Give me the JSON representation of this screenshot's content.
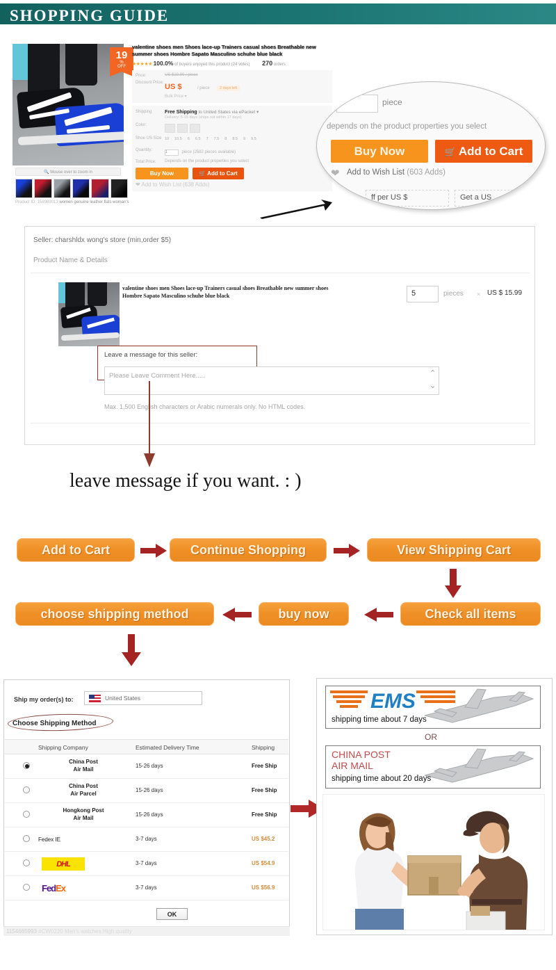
{
  "banner": {
    "title": "SHOPPING GUIDE",
    "color": "#1c7573"
  },
  "product_page": {
    "discount_badge": {
      "value": "19",
      "unit": "%",
      "label": "OFF"
    },
    "title": "valentine shoes men Shoes lace-up Trainers casual shoes Breathable new summer shoes Hombre Sapato Masculino schuhe blue black",
    "rating": {
      "stars": "★★★★★",
      "percent": "100.0%",
      "text": "of buyers enjoyed this product (24 votes)",
      "orders_count": "270",
      "orders_label": "orders"
    },
    "zoom_hint": "Mouse over to zoom in",
    "product_id_label": "Product ID:",
    "product_id": "158989013",
    "product_id_suffix": "women genuine leather flats woman's",
    "price_rows": [
      {
        "label": "Price:",
        "value": "US $19.99 / piece"
      },
      {
        "label": "Discount Price:",
        "value": "US $",
        "unit": "/ piece",
        "tag": "2 days left"
      },
      {
        "label": "",
        "value": "Bulk Price ▾"
      }
    ],
    "shipping_label": "Shipping",
    "shipping_value_bold": "Free Shipping",
    "shipping_value_rest": "to United States via ePacket",
    "shipping_sub": "Delivery: 5-15 days (ships out within 17 days)",
    "color_label": "Color:",
    "size_label": "Shoe US Size",
    "sizes": [
      "10",
      "10.5",
      "6",
      "6.5",
      "7",
      "7.5",
      "8",
      "8.5",
      "9",
      "9.5"
    ],
    "quantity_label": "Quantity:",
    "quantity_value": "1",
    "quantity_note": "piece (2582 pieces available)",
    "total_price_label": "Total Price:",
    "total_price_value": "Depends on the product properties you select",
    "buy_now": "Buy Now",
    "add_to_cart": "Add to Cart",
    "wish_list": "Add to Wish List",
    "wish_count": "(638 Adds)"
  },
  "magnifier": {
    "piece_label": "piece",
    "depends_text": "depends on the product properties you select",
    "buy_now": "Buy Now",
    "add_to_cart": "Add to Cart",
    "wish_list": "Add to Wish List",
    "wish_count": "(603 Adds)",
    "bottom_left": "ff per US $",
    "bottom_right": "Get a US"
  },
  "cart_panel": {
    "seller": "Seller: charshldx wong's store (min,order $5)",
    "product_name_details": "Product Name & Details",
    "item_title": "valentine shoes men Shoes lace-up Trainers casual shoes Breathable new summer shoes Hombre Sapato Masculino schuhe blue black",
    "quantity": "5",
    "quantity_unit": "pieces",
    "multiply": "×",
    "unit_price": "US $ 15.99",
    "message_label": "Leave a message for this seller:",
    "message_placeholder": "Please Leave Comment Here.....",
    "max_note": "Max. 1,500 English characters or Arabic numerals only. No HTML codes."
  },
  "caption": "leave message if you want. : )",
  "flow": {
    "steps": [
      "Add to Cart",
      "Continue Shopping",
      "View Shipping Cart",
      "Check all items",
      "buy now",
      "choose shipping method"
    ],
    "pill_color": "#ef8f26",
    "arrow_color": "#a42424"
  },
  "shipping_panel": {
    "ship_to_label": "Ship my order(s) to:",
    "ship_to_value": "United States",
    "choose_method": "Choose Shipping Method",
    "columns": [
      "Shipping Company",
      "Estimated Delivery Time",
      "Shipping"
    ],
    "rows": [
      {
        "company": "China Post\nAir Mail",
        "company_line1": "China Post",
        "company_line2": "Air Mail",
        "time": "15-26 days",
        "cost": "Free Ship",
        "selected": true,
        "logo": "none"
      },
      {
        "company_line1": "China Post",
        "company_line2": "Air Parcel",
        "time": "15-26 days",
        "cost": "Free Ship",
        "selected": false,
        "logo": "none"
      },
      {
        "company_line1": "Hongkong Post",
        "company_line2": "Air Mail",
        "time": "15-26 days",
        "cost": "Free Ship",
        "selected": false,
        "logo": "none"
      },
      {
        "company_line1": "Fedex IE",
        "company_line2": "",
        "time": "3-7 days",
        "cost": "US $45.2",
        "selected": false,
        "logo": "none"
      },
      {
        "company_line1": "",
        "company_line2": "",
        "time": "3-7 days",
        "cost": "US $54.9",
        "selected": false,
        "logo": "dhl"
      },
      {
        "company_line1": "",
        "company_line2": "",
        "time": "3-7 days",
        "cost": "US $56.9",
        "selected": false,
        "logo": "fedex"
      }
    ],
    "ok_button": "OK",
    "watermark_id": "1154665993",
    "watermark_text": "#CW0220 Men's watches High quality"
  },
  "delivery_panel": {
    "ems_logo": "EMS",
    "ems_time": "shipping time about 7 days",
    "or": "OR",
    "china_post_line1": "CHINA POST",
    "china_post_line2": "AIR MAIL",
    "china_post_time": "shipping time about 20 days"
  }
}
